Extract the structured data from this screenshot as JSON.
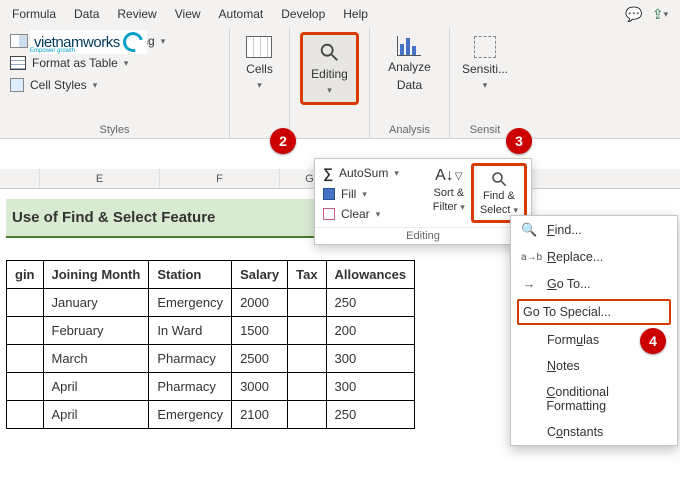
{
  "tabs": {
    "formula": "Formula",
    "data": "Data",
    "review": "Review",
    "view": "View",
    "automat": "Automat",
    "develop": "Develop",
    "help": "Help"
  },
  "logo": {
    "name": "vietnamworks",
    "tagline": "Empower growth"
  },
  "styles": {
    "cond": "Conditional Formatting",
    "table": "Format as Table",
    "cell": "Cell Styles",
    "label": "Styles"
  },
  "groups": {
    "cells": "Cells",
    "editing": "Editing",
    "analyze1": "Analyze",
    "analyze2": "Data",
    "analyzeLabel": "Analysis",
    "sens": "Sensiti...",
    "sensLabel": "Sensit"
  },
  "badges": {
    "b2": "2",
    "b3": "3",
    "b4": "4"
  },
  "dropdown": {
    "autosum": "AutoSum",
    "fill": "Fill",
    "clear": "Clear",
    "sort1": "Sort &",
    "sort2": "Filter",
    "find1": "Find &",
    "find2": "Select",
    "label": "Editing"
  },
  "menu": {
    "find": "Find...",
    "replace": "Replace...",
    "goto": "Go To...",
    "gotospecial": "Go To Special...",
    "formulas": "Formulas",
    "notes": "Notes",
    "condfmt": "Conditional Formatting",
    "constants": "Constants"
  },
  "cols": {
    "e": "E",
    "f": "F",
    "g": "G"
  },
  "title": "Use of Find & Select Feature",
  "headers": {
    "c0": "gin",
    "c1": "Joining Month",
    "c2": "Station",
    "c3": "Salary",
    "c4": "Tax",
    "c5": "Allowances"
  },
  "rows": [
    {
      "c1": "January",
      "c2": "Emergency",
      "c3": "2000",
      "c4": "",
      "c5": "250"
    },
    {
      "c1": "February",
      "c2": "In Ward",
      "c3": "1500",
      "c4": "",
      "c5": "200"
    },
    {
      "c1": "March",
      "c2": "Pharmacy",
      "c3": "2500",
      "c4": "",
      "c5": "300"
    },
    {
      "c1": "April",
      "c2": "Pharmacy",
      "c3": "3000",
      "c4": "",
      "c5": "300"
    },
    {
      "c1": "April",
      "c2": "Emergency",
      "c3": "2100",
      "c4": "",
      "c5": "250"
    }
  ]
}
